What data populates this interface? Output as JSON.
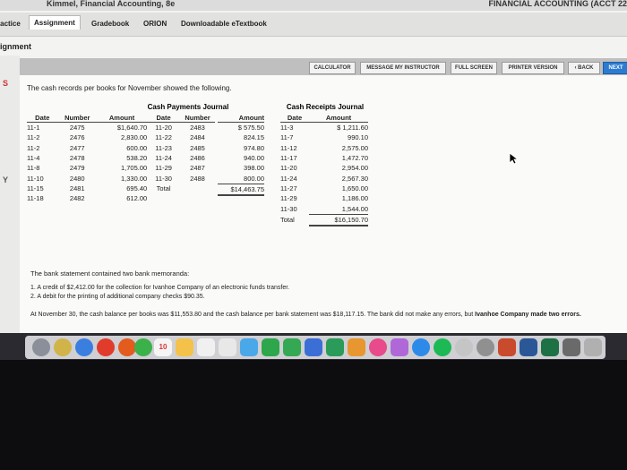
{
  "window": {
    "title_left": "Kimmel, Financial Accounting, 8e",
    "title_right": "FINANCIAL ACCOUNTING (ACCT 22"
  },
  "nav": {
    "tabs": [
      "ractice",
      "Assignment",
      "Gradebook",
      "ORION",
      "Downloadable eTextbook"
    ],
    "active": "Assignment"
  },
  "section_title": "ignment",
  "left_letters": [
    "S",
    "Y"
  ],
  "toolbar": {
    "buttons": [
      "CALCULATOR",
      "MESSAGE MY INSTRUCTOR",
      "FULL SCREEN",
      "PRINTER VERSION",
      "‹ BACK",
      "NEXT"
    ]
  },
  "intro": "The cash records per books for November showed the following.",
  "cash_payments": {
    "title": "Cash Payments Journal",
    "headers": [
      "Date",
      "Number",
      "Amount",
      "Date",
      "Number",
      "Amount"
    ],
    "left_rows": [
      [
        "11-1",
        "2475",
        "$1,640.70"
      ],
      [
        "11-2",
        "2476",
        "2,830.00"
      ],
      [
        "11-2",
        "2477",
        "600.00"
      ],
      [
        "11-4",
        "2478",
        "538.20"
      ],
      [
        "11-8",
        "2479",
        "1,705.00"
      ],
      [
        "11-10",
        "2480",
        "1,330.00"
      ],
      [
        "11-15",
        "2481",
        "695.40"
      ],
      [
        "11-18",
        "2482",
        "612.00"
      ]
    ],
    "right_rows": [
      [
        "11-20",
        "2483",
        "$ 575.50"
      ],
      [
        "11-22",
        "2484",
        "824.15"
      ],
      [
        "11-23",
        "2485",
        "974.80"
      ],
      [
        "11-24",
        "2486",
        "940.00"
      ],
      [
        "11-29",
        "2487",
        "398.00"
      ],
      [
        "11-30",
        "2488",
        "800.00"
      ],
      [
        "Total",
        "",
        "$14,463.75"
      ]
    ]
  },
  "cash_receipts": {
    "title": "Cash Receipts Journal",
    "headers": [
      "Date",
      "Amount"
    ],
    "rows": [
      [
        "11-3",
        "$ 1,211.60"
      ],
      [
        "11-7",
        "990.10"
      ],
      [
        "11-12",
        "2,575.00"
      ],
      [
        "11-17",
        "1,472.70"
      ],
      [
        "11-20",
        "2,954.00"
      ],
      [
        "11-24",
        "2,567.30"
      ],
      [
        "11-27",
        "1,650.00"
      ],
      [
        "11-29",
        "1,186.00"
      ],
      [
        "11-30",
        "1,544.00"
      ],
      [
        "Total",
        "$16,150.70"
      ]
    ]
  },
  "bank_intro": "The bank statement contained two bank memoranda:",
  "memos": [
    "1. A credit of $2,412.00 for the collection for Ivanhoe Company of an electronic funds transfer.",
    "2. A debit for the printing of additional company checks $90.35."
  ],
  "final_text": "At November 30, the cash balance per books was $11,553.80 and the cash balance per bank statement was $18,117.15. The bank did not make any errors, but",
  "final_bold": "Ivanhoe Company made two errors.",
  "dock": {
    "calendar_day": "10"
  }
}
